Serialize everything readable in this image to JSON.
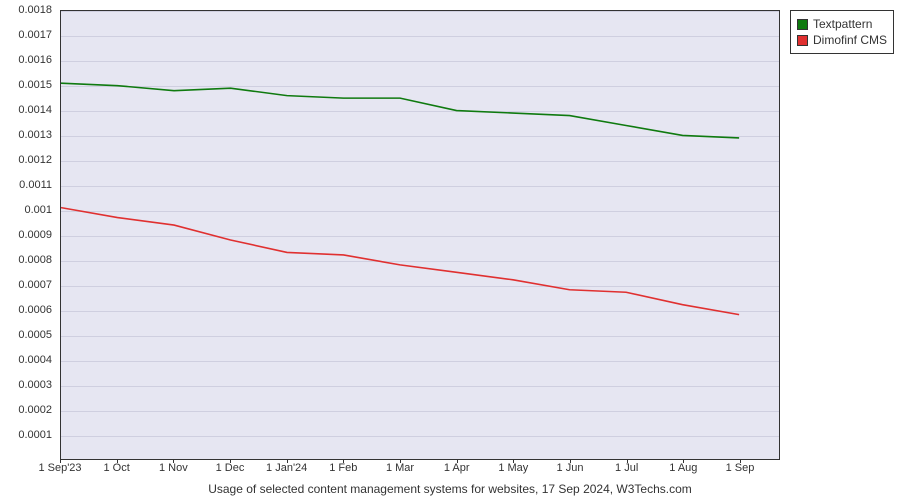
{
  "chart_data": {
    "type": "line",
    "title": "",
    "caption": "Usage of selected content management systems for websites, 17 Sep 2024, W3Techs.com",
    "xlabel": "",
    "ylabel": "",
    "ylim": [
      0,
      0.0018
    ],
    "y_ticks": [
      0.0001,
      0.0002,
      0.0003,
      0.0004,
      0.0005,
      0.0006,
      0.0007,
      0.0008,
      0.0009,
      0.001,
      0.0011,
      0.0012,
      0.0013,
      0.0014,
      0.0015,
      0.0016,
      0.0017,
      0.0018
    ],
    "categories": [
      "1 Sep'23",
      "1 Oct",
      "1 Nov",
      "1 Dec",
      "1 Jan'24",
      "1 Feb",
      "1 Mar",
      "1 Apr",
      "1 May",
      "1 Jun",
      "1 Jul",
      "1 Aug",
      "1 Sep"
    ],
    "series": [
      {
        "name": "Textpattern",
        "color": "#0f7a0f",
        "values": [
          0.00151,
          0.0015,
          0.00148,
          0.00149,
          0.00146,
          0.00145,
          0.00145,
          0.0014,
          0.00139,
          0.00138,
          0.00134,
          0.0013,
          0.00129
        ]
      },
      {
        "name": "Dimofinf CMS",
        "color": "#e03030",
        "values": [
          0.00101,
          0.00097,
          0.00094,
          0.00088,
          0.00083,
          0.00082,
          0.00078,
          0.00075,
          0.00072,
          0.00068,
          0.00067,
          0.00062,
          0.00058
        ]
      }
    ],
    "legend_position": "right",
    "grid": true
  }
}
